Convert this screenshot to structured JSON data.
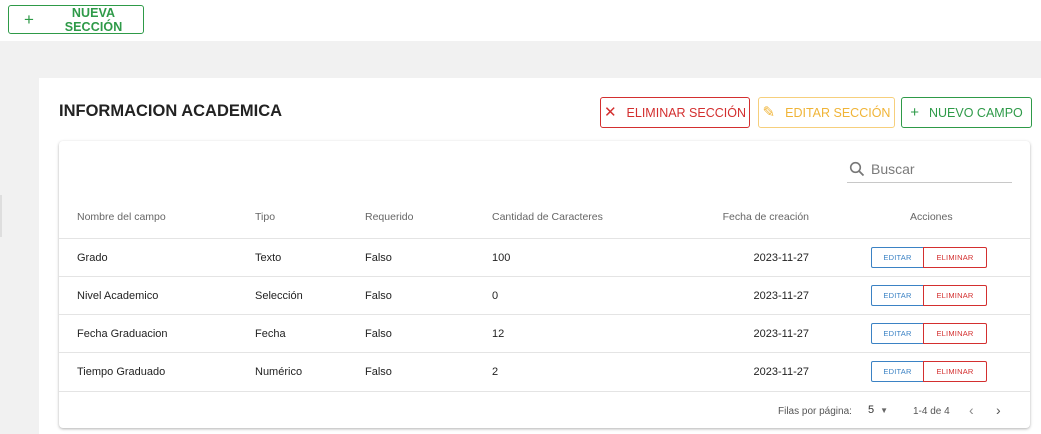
{
  "top": {
    "new_section_label": "NUEVA SECCIÓN"
  },
  "section": {
    "title": "INFORMACION ACADEMICA",
    "delete_label": "ELIMINAR SECCIÓN",
    "edit_label": "EDITAR SECCIÓN",
    "new_field_label": "NUEVO CAMPO"
  },
  "search": {
    "placeholder": "Buscar"
  },
  "table": {
    "headers": {
      "name": "Nombre del campo",
      "type": "Tipo",
      "required": "Requerido",
      "chars": "Cantidad de Caracteres",
      "created": "Fecha de creación",
      "actions": "Acciones"
    },
    "rows": [
      {
        "name": "Grado",
        "type": "Texto",
        "required": "Falso",
        "chars": "100",
        "created": "2023-11-27",
        "edit": "EDITAR",
        "delete": "ELIMINAR"
      },
      {
        "name": "Nivel Academico",
        "type": "Selección",
        "required": "Falso",
        "chars": "0",
        "created": "2023-11-27",
        "edit": "EDITAR",
        "delete": "ELIMINAR"
      },
      {
        "name": "Fecha Graduacion",
        "type": "Fecha",
        "required": "Falso",
        "chars": "12",
        "created": "2023-11-27",
        "edit": "EDITAR",
        "delete": "ELIMINAR"
      },
      {
        "name": "Tiempo Graduado",
        "type": "Numérico",
        "required": "Falso",
        "chars": "2",
        "created": "2023-11-27",
        "edit": "EDITAR",
        "delete": "ELIMINAR"
      }
    ]
  },
  "pagination": {
    "rows_per_page_label": "Filas por página:",
    "rows_per_page_value": "5",
    "range": "1-4 de 4"
  },
  "colors": {
    "green": "#2e9a48",
    "red": "#d32f2f",
    "yellow": "#f0b437",
    "blue": "#3b82c4"
  }
}
